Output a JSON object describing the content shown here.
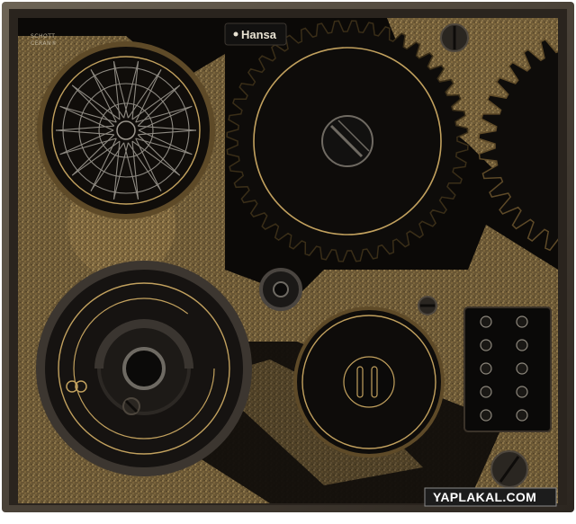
{
  "cooktop": {
    "brand": "Hansa",
    "glass_maker_line1": "SCHOTT",
    "glass_maker_line2": "CERAN®",
    "colors": {
      "frame": "#5b5245",
      "glass": "#0b0907",
      "gold": "#a88a50",
      "gold_dark": "#5e4a28",
      "ring": "#c2a15e",
      "panel": "#0a0908"
    }
  },
  "watermark": {
    "text": "YAPLAKAL.COM",
    "background": "#1c1c1c"
  },
  "control_panel": {
    "button_icons": [
      "zone-front-left-icon",
      "zone-rear-left-icon",
      "zone-front-right-icon",
      "zone-rear-right-icon",
      "lock-icon",
      "timer-icon",
      "minus-icon",
      "plus-icon",
      "power-icon",
      "settings-icon"
    ]
  }
}
